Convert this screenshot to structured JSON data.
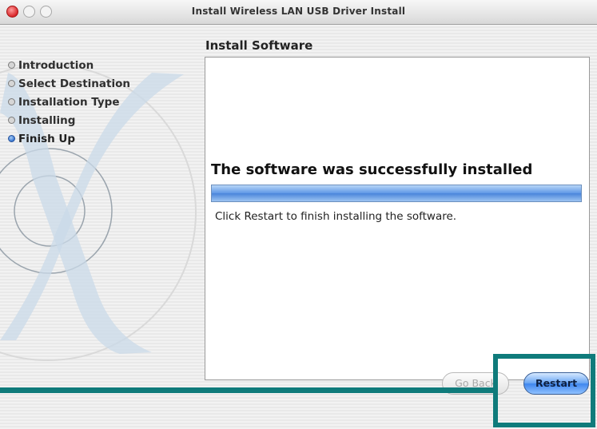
{
  "window": {
    "title": "Install Wireless LAN USB Driver Install"
  },
  "sidebar": {
    "steps": [
      {
        "label": "Introduction"
      },
      {
        "label": "Select Destination"
      },
      {
        "label": "Installation Type"
      },
      {
        "label": "Installing"
      },
      {
        "label": "Finish Up"
      }
    ],
    "active_step": "Finish Up"
  },
  "main": {
    "section_title": "Install Software",
    "headline": "The software was successfully installed",
    "progress": 1.0,
    "instruction": "Click Restart to finish installing the software."
  },
  "buttons": {
    "back_label": "Go Back",
    "restart_label": "Restart"
  },
  "colors": {
    "highlight": "#0f7b7b",
    "progress": "#4a85db",
    "close_button": "#d9272a"
  },
  "icons": [
    "close-icon",
    "minimize-icon",
    "zoom-icon",
    "mac-os-x-logo"
  ]
}
